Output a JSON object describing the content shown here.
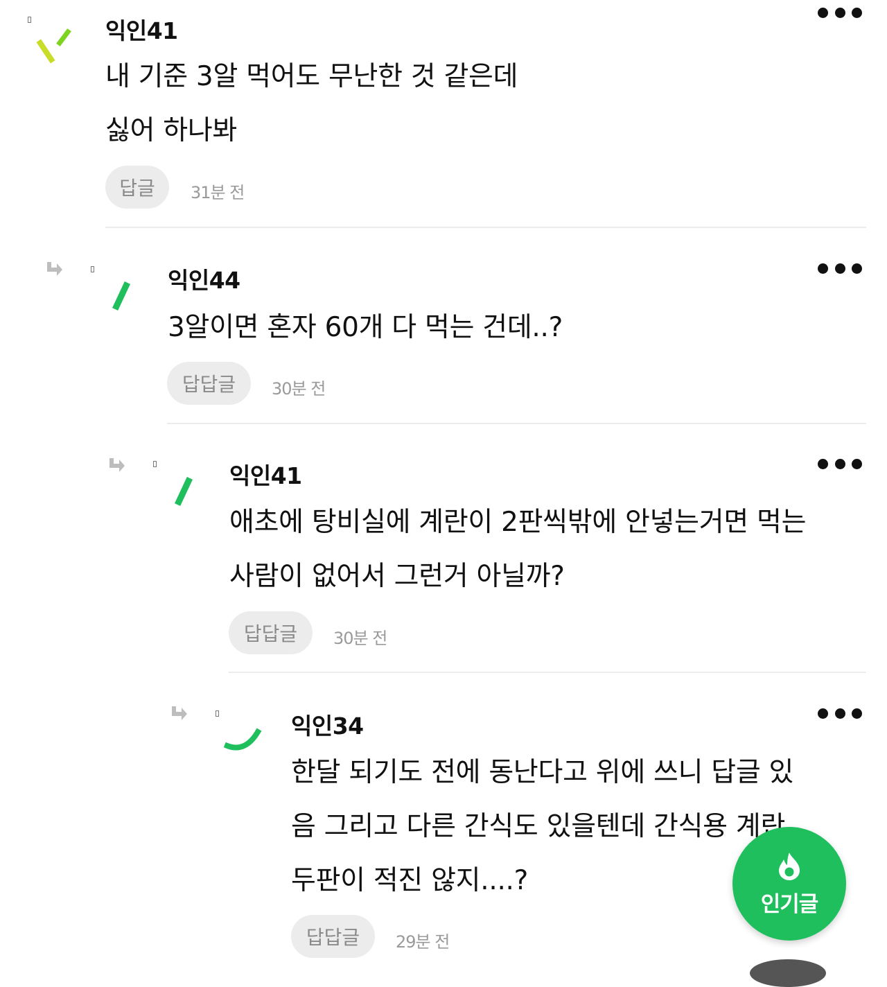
{
  "comments": [
    {
      "author": "익인41",
      "lines": [
        "내 기준 3알 먹어도 무난한 것 같은데",
        "싫어 하나봐"
      ],
      "reply_label": "답글",
      "time": "31분 전"
    },
    {
      "author": "익인44",
      "lines": [
        "3알이면 혼자 60개 다 먹는 건데..?"
      ],
      "reply_label": "답답글",
      "time": "30분 전"
    },
    {
      "author": "익인41",
      "lines": [
        "애초에 탕비실에 계란이 2판씩밖에 안넣는거면 먹는",
        "사람이 없어서 그런거 아닐까?"
      ],
      "reply_label": "답답글",
      "time": "30분 전"
    },
    {
      "author": "익인34",
      "lines": [
        "한달 되기도 전에 동난다고 위에 쓰니 답글 있",
        "음 그리고 다른 간식도 있을텐데 간식용 계란",
        "두판이 적진 않지....?"
      ],
      "reply_label": "답답글",
      "time": "29분 전"
    }
  ],
  "fab": {
    "label": "인기글",
    "icon": "fire-icon",
    "color": "#1fbf5e"
  },
  "colors": {
    "avatar_lime": "#c9dc2a",
    "avatar_green": "#1fbf5e",
    "avatar_light_green": "#7ed321"
  }
}
